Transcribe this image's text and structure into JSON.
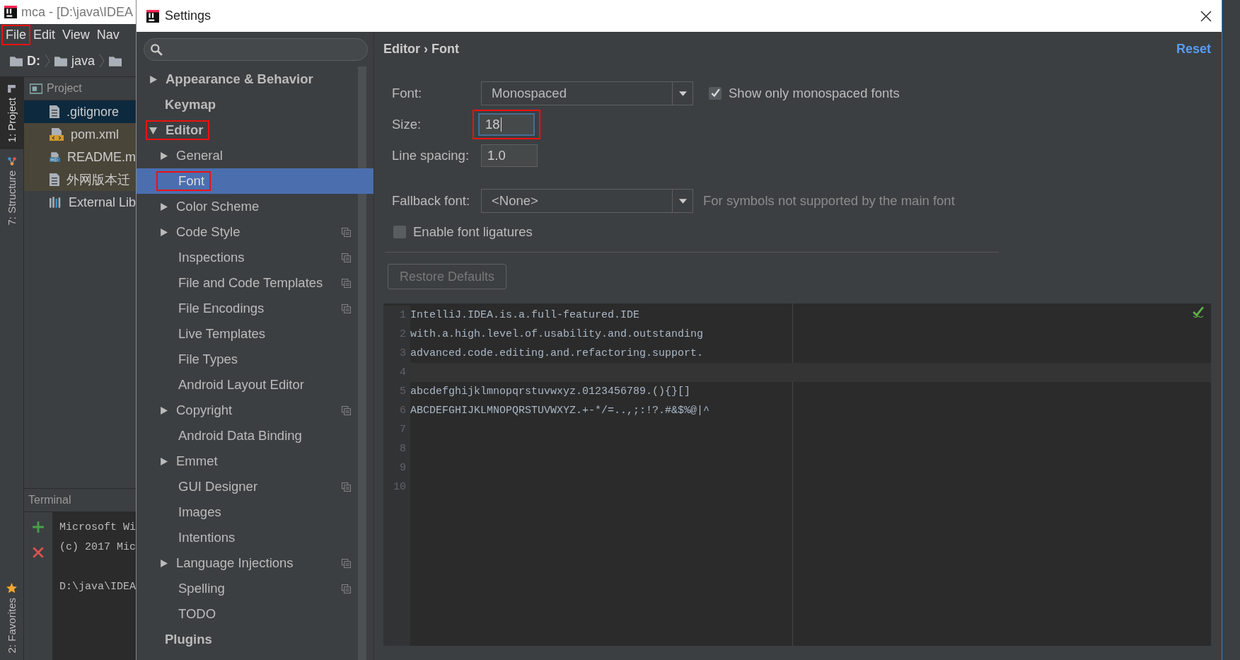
{
  "ide": {
    "title": "mca - [D:\\java\\IDEA",
    "menu": [
      {
        "label": "File",
        "highlighted": true
      },
      {
        "label": "Edit",
        "highlighted": false
      },
      {
        "label": "View",
        "highlighted": false
      },
      {
        "label": "Nav",
        "highlighted": false
      }
    ],
    "breadcrumb": [
      "D:",
      "java"
    ],
    "tool_windows_top": [
      {
        "label": "1: Project",
        "selected": true,
        "kind": "project"
      },
      {
        "label": "7: Structure",
        "selected": false,
        "kind": "structure"
      }
    ],
    "tool_windows_bottom": [
      {
        "label": "2: Favorites",
        "selected": false,
        "kind": "favorites"
      }
    ],
    "project": {
      "title": "Project",
      "items": [
        {
          "name": ".gitignore",
          "kind": "text",
          "selected": true,
          "unversioned": false
        },
        {
          "name": "pom.xml",
          "kind": "maven",
          "selected": false,
          "unversioned": true
        },
        {
          "name": "README.m",
          "kind": "markdown",
          "selected": false,
          "unversioned": true
        },
        {
          "name": "外网版本迁",
          "kind": "text",
          "selected": false,
          "unversioned": true
        },
        {
          "name": "External Lib",
          "kind": "library",
          "selected": false,
          "unversioned": false
        }
      ]
    },
    "terminal": {
      "title": "Terminal",
      "output": [
        "Microsoft Wi",
        "(c) 2017 Mic"
      ],
      "prompt": "D:\\java\\IDEA"
    }
  },
  "dialog": {
    "title": "Settings",
    "tree": [
      {
        "label": "Appearance & Behavior",
        "expandable": true,
        "expanded": false,
        "selected": false,
        "highlighted": false,
        "project_scoped": false
      },
      {
        "label": "Keymap",
        "expandable": false,
        "selected": false,
        "highlighted": false,
        "project_scoped": false
      },
      {
        "label": "Editor",
        "expandable": true,
        "expanded": true,
        "selected": false,
        "highlighted": true,
        "project_scoped": false,
        "children": [
          {
            "label": "General",
            "expandable": true,
            "expanded": false,
            "selected": false,
            "highlighted": false,
            "project_scoped": false
          },
          {
            "label": "Font",
            "expandable": false,
            "selected": true,
            "highlighted": true,
            "project_scoped": false
          },
          {
            "label": "Color Scheme",
            "expandable": true,
            "expanded": false,
            "selected": false,
            "highlighted": false,
            "project_scoped": false
          },
          {
            "label": "Code Style",
            "expandable": true,
            "expanded": false,
            "selected": false,
            "highlighted": false,
            "project_scoped": true
          },
          {
            "label": "Inspections",
            "expandable": false,
            "selected": false,
            "highlighted": false,
            "project_scoped": true
          },
          {
            "label": "File and Code Templates",
            "expandable": false,
            "selected": false,
            "highlighted": false,
            "project_scoped": true
          },
          {
            "label": "File Encodings",
            "expandable": false,
            "selected": false,
            "highlighted": false,
            "project_scoped": true
          },
          {
            "label": "Live Templates",
            "expandable": false,
            "selected": false,
            "highlighted": false,
            "project_scoped": false
          },
          {
            "label": "File Types",
            "expandable": false,
            "selected": false,
            "highlighted": false,
            "project_scoped": false
          },
          {
            "label": "Android Layout Editor",
            "expandable": false,
            "selected": false,
            "highlighted": false,
            "project_scoped": false
          },
          {
            "label": "Copyright",
            "expandable": true,
            "expanded": false,
            "selected": false,
            "highlighted": false,
            "project_scoped": true
          },
          {
            "label": "Android Data Binding",
            "expandable": false,
            "selected": false,
            "highlighted": false,
            "project_scoped": false
          },
          {
            "label": "Emmet",
            "expandable": true,
            "expanded": false,
            "selected": false,
            "highlighted": false,
            "project_scoped": false
          },
          {
            "label": "GUI Designer",
            "expandable": false,
            "selected": false,
            "highlighted": false,
            "project_scoped": true
          },
          {
            "label": "Images",
            "expandable": false,
            "selected": false,
            "highlighted": false,
            "project_scoped": false
          },
          {
            "label": "Intentions",
            "expandable": false,
            "selected": false,
            "highlighted": false,
            "project_scoped": false
          },
          {
            "label": "Language Injections",
            "expandable": true,
            "expanded": false,
            "selected": false,
            "highlighted": false,
            "project_scoped": true
          },
          {
            "label": "Spelling",
            "expandable": false,
            "selected": false,
            "highlighted": false,
            "project_scoped": true
          },
          {
            "label": "TODO",
            "expandable": false,
            "selected": false,
            "highlighted": false,
            "project_scoped": false
          }
        ]
      },
      {
        "label": "Plugins",
        "expandable": false,
        "selected": false,
        "highlighted": false,
        "project_scoped": false
      }
    ],
    "breadcrumb": "Editor › Font",
    "reset": "Reset",
    "font": {
      "label": "Font:",
      "value": "Monospaced"
    },
    "monospaced_only": {
      "label": "Show only monospaced fonts",
      "checked": true
    },
    "size": {
      "label": "Size:",
      "value": "18",
      "highlighted": true,
      "focused": true
    },
    "line_spacing": {
      "label": "Line spacing:",
      "value": "1.0"
    },
    "fallback": {
      "label": "Fallback font:",
      "value": "<None>",
      "hint": "For symbols not supported by the main font"
    },
    "ligatures": {
      "label": "Enable font ligatures",
      "checked": false
    },
    "restore": {
      "label": "Restore Defaults",
      "disabled": true
    },
    "preview": {
      "lines": [
        {
          "number": "1",
          "text": "IntelliJ.IDEA.is.a.full-featured.IDE",
          "current": false
        },
        {
          "number": "2",
          "text": "with.a.high.level.of.usability.and.outstanding",
          "current": false
        },
        {
          "number": "3",
          "text": "advanced.code.editing.and.refactoring.support.",
          "current": false
        },
        {
          "number": "4",
          "current": true
        },
        {
          "number": "5",
          "text": "abcdefghijklmnopqrstuvwxyz.0123456789.(){}[]",
          "current": false
        },
        {
          "number": "6",
          "text": "ABCDEFGHIJKLMNOPQRSTUVWXYZ.+-*/=..,;:!?.#&$%@|^",
          "current": false
        },
        {
          "number": "7",
          "current": false
        },
        {
          "number": "8",
          "current": false
        },
        {
          "number": "9",
          "current": false
        },
        {
          "number": "10",
          "current": false
        }
      ]
    }
  }
}
